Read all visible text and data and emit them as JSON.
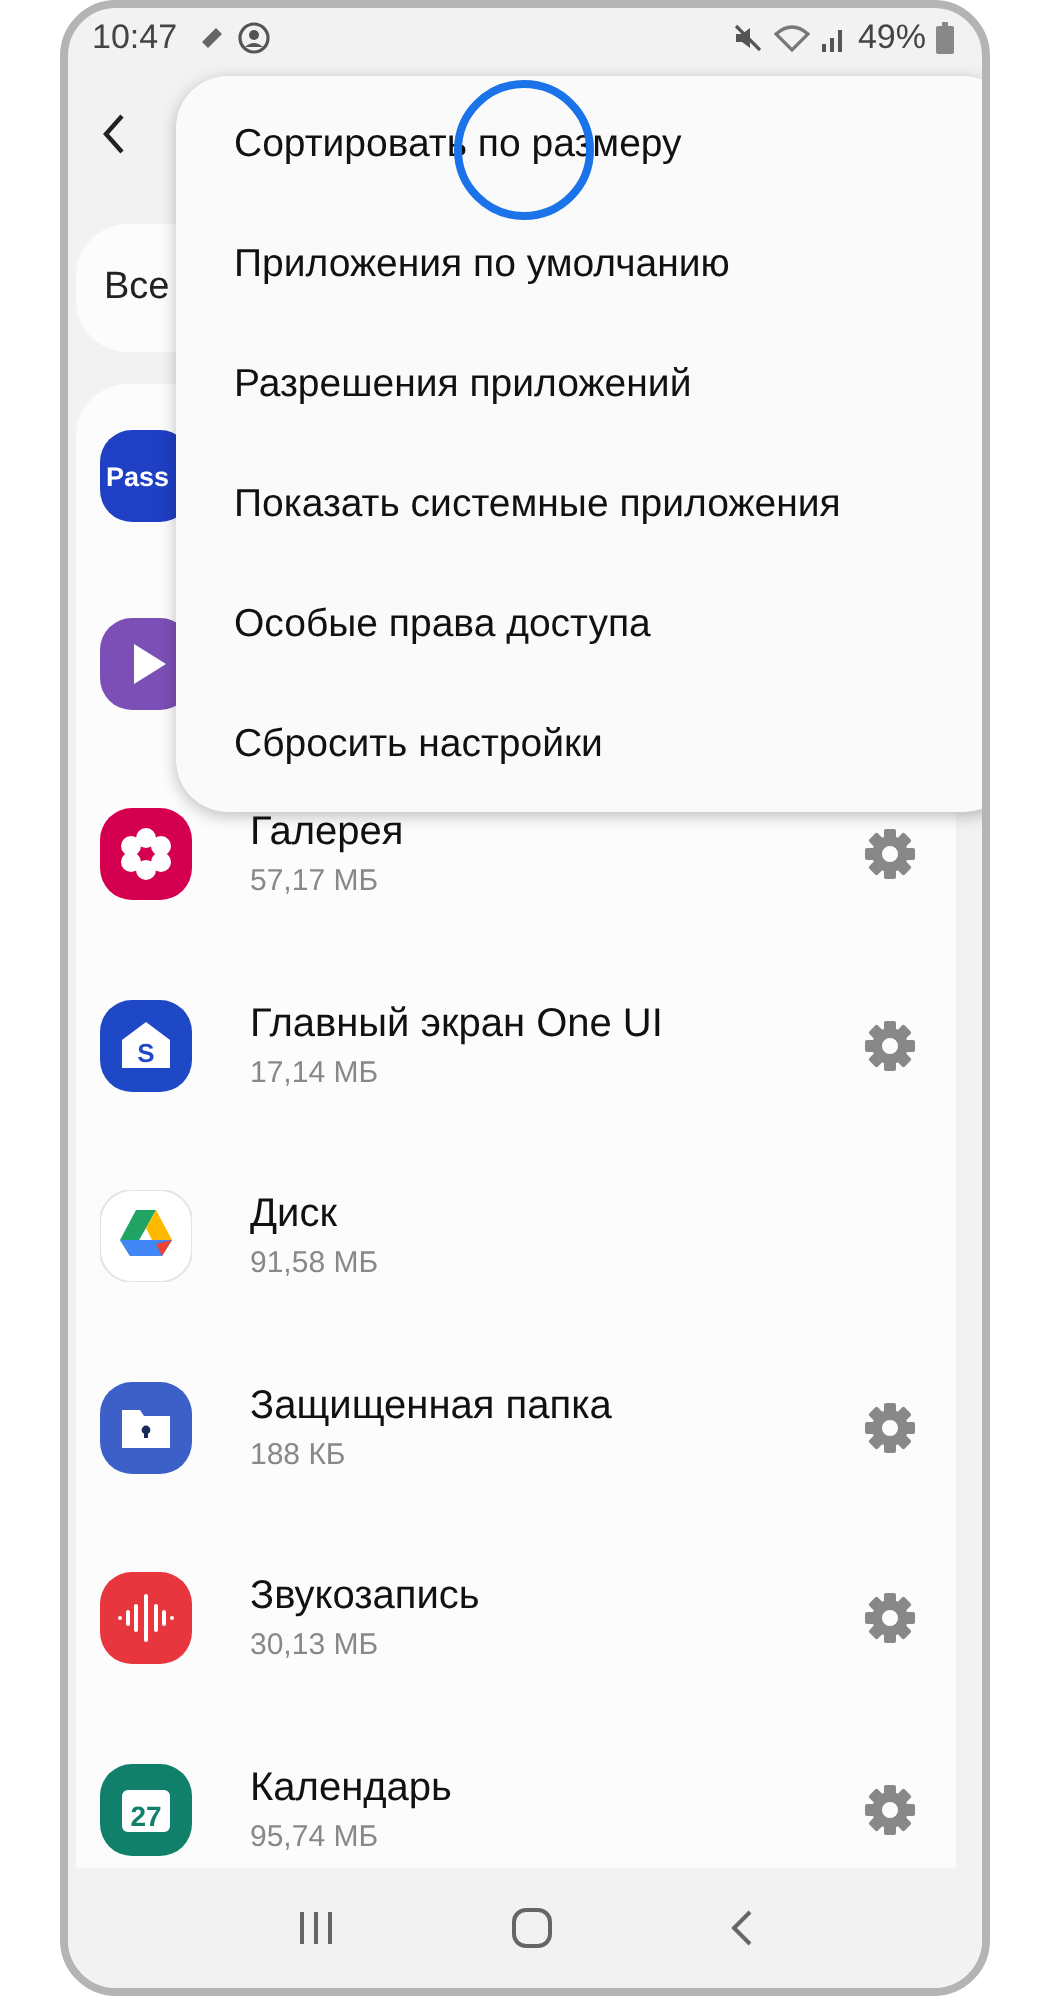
{
  "status_bar": {
    "time": "10:47",
    "battery": "49%"
  },
  "menu": {
    "items": [
      {
        "label": "Сортировать по размеру"
      },
      {
        "label": "Приложения по умолчанию"
      },
      {
        "label": "Разрешения приложений"
      },
      {
        "label": "Показать системные приложения"
      },
      {
        "label": "Особые права доступа"
      },
      {
        "label": "Сбросить настройки"
      }
    ]
  },
  "filter": {
    "value": "Все"
  },
  "apps": [
    {
      "kind": "pass",
      "icon_label": "Pass"
    },
    {
      "kind": "video"
    },
    {
      "kind": "gallery",
      "name": "Галерея",
      "size": "57,17 МБ",
      "settings": true
    },
    {
      "kind": "home",
      "icon_label": "S",
      "name": "Главный экран One UI",
      "size": "17,14 МБ",
      "settings": true
    },
    {
      "kind": "drive",
      "name": "Диск",
      "size": "91,58 МБ",
      "settings": false
    },
    {
      "kind": "folder",
      "name": "Защищенная папка",
      "size": "188 КБ",
      "settings": true
    },
    {
      "kind": "recorder",
      "name": "Звукозапись",
      "size": "30,13 МБ",
      "settings": true
    },
    {
      "kind": "calendar",
      "icon_label": "27",
      "name": "Календарь",
      "size": "95,74 МБ",
      "settings": true
    }
  ]
}
